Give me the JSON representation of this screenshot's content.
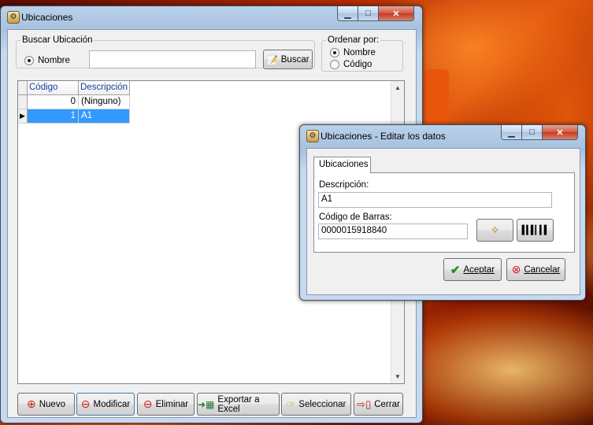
{
  "main_window": {
    "title": "Ubicaciones",
    "search_group": {
      "legend": "Buscar Ubicación",
      "radio_nombre": "Nombre",
      "search_value": "",
      "search_button": "Buscar"
    },
    "order_group": {
      "legend": "Ordenar por:",
      "options": [
        "Nombre",
        "Código"
      ],
      "selected": "Nombre"
    },
    "grid": {
      "columns": [
        "Código",
        "Descripción"
      ],
      "rows": [
        {
          "codigo": "0",
          "descripcion": "(Ninguno)"
        },
        {
          "codigo": "1",
          "descripcion": "A1"
        }
      ],
      "selected_row": 1
    },
    "buttons": {
      "nuevo": "Nuevo",
      "modificar": "Modificar",
      "eliminar": "Eliminar",
      "exportar": "Exportar a Excel",
      "seleccionar": "Seleccionar",
      "cerrar": "Cerrar"
    }
  },
  "edit_dialog": {
    "title": "Ubicaciones - Editar los datos",
    "tab": "Ubicaciones",
    "descripcion_label": "Descripción:",
    "descripcion_value": "A1",
    "codigo_label": "Código de Barras:",
    "codigo_value": "0000015918840",
    "aceptar": "Aceptar",
    "cancelar": "Cancelar"
  }
}
